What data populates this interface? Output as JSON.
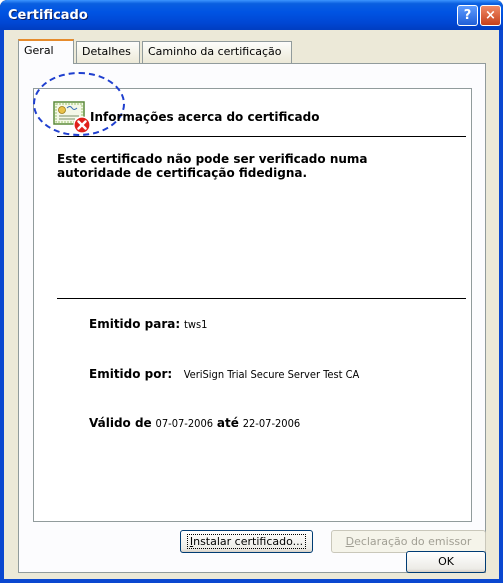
{
  "window": {
    "title": "Certificado",
    "help_button": "?",
    "close_button": "×"
  },
  "tabs": [
    {
      "label": "Geral",
      "active": true
    },
    {
      "label": "Detalhes",
      "active": false
    },
    {
      "label": "Caminho da certificação",
      "active": false
    }
  ],
  "info": {
    "heading": "Informações acerca do certificado",
    "message": "Este certificado não pode ser verificado numa autoridade de certificação fidedigna.",
    "issued_to_label": "Emitido para:",
    "issued_to_value": "tws1",
    "issued_by_label": "Emitido por:",
    "issued_by_value": "VeriSign Trial Secure Server Test CA",
    "valid_from_label": "Válido de",
    "valid_from_value": "07-07-2006",
    "valid_to_label": "até",
    "valid_to_value": "22-07-2006"
  },
  "buttons": {
    "install_prefix": "I",
    "install_rest": "nstalar certificado...",
    "declaration_prefix": "D",
    "declaration_rest": "eclaração do emissor",
    "ok": "OK"
  },
  "colors": {
    "titlebar": "#0054e3",
    "face": "#ece9d8",
    "active_tab_accent": "#e68b2c",
    "annotation_circle": "#1f3fcf",
    "error_badge": "#e0201a"
  },
  "icons": {
    "certificate": "certificate-error-icon",
    "help": "help-icon",
    "close": "close-icon"
  }
}
